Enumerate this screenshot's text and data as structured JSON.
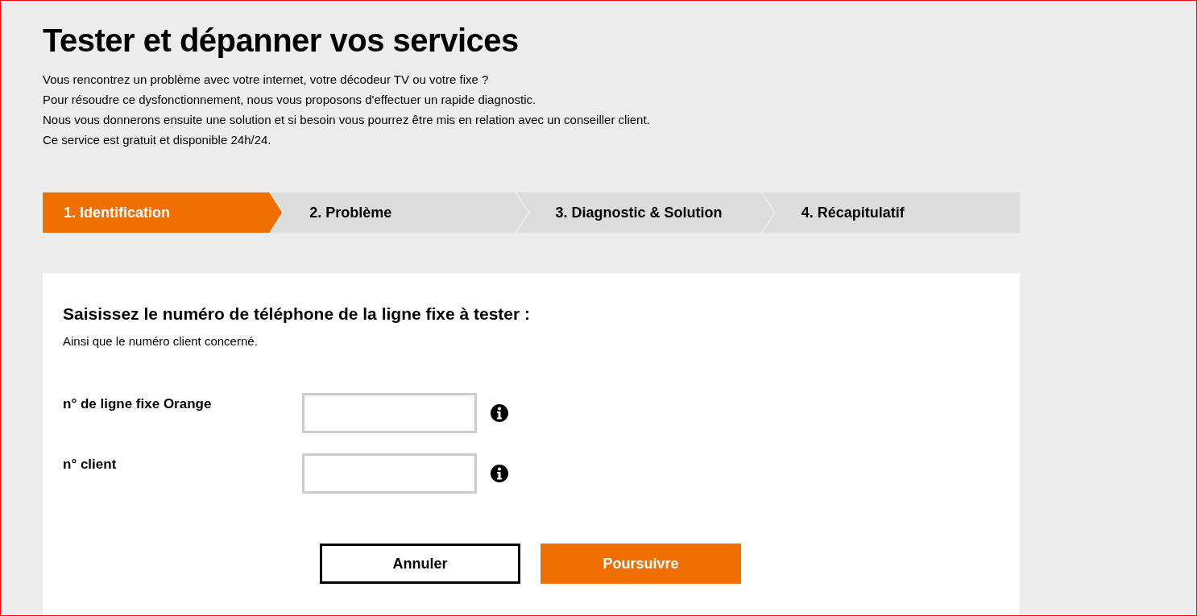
{
  "page": {
    "title": "Tester et dépanner vos services",
    "intro": [
      "Vous rencontrez un problème avec votre internet, votre décodeur TV ou votre fixe ?",
      "Pour résoudre ce dysfonctionnement, nous vous proposons d'effectuer un rapide diagnostic.",
      "Nous vous donnerons ensuite une solution et si besoin vous pourrez être mis en relation avec un conseiller client.",
      "Ce service est gratuit et disponible 24h/24."
    ]
  },
  "steps": [
    {
      "label": "1. Identification",
      "selected": true
    },
    {
      "label": "2. Problème",
      "selected": false
    },
    {
      "label": "3. Diagnostic & Solution",
      "selected": false
    },
    {
      "label": "4. Récapitulatif",
      "selected": false
    }
  ],
  "form": {
    "heading": "Saisissez le numéro de téléphone de la ligne fixe à tester :",
    "subheading": "Ainsi que le numéro client concerné.",
    "fields": [
      {
        "label": "n° de ligne fixe Orange"
      },
      {
        "label": "n° client"
      }
    ],
    "buttons": [
      {
        "label": "Annuler",
        "kind": "secondary"
      },
      {
        "label": "Poursuivre",
        "kind": "primary"
      }
    ]
  }
}
